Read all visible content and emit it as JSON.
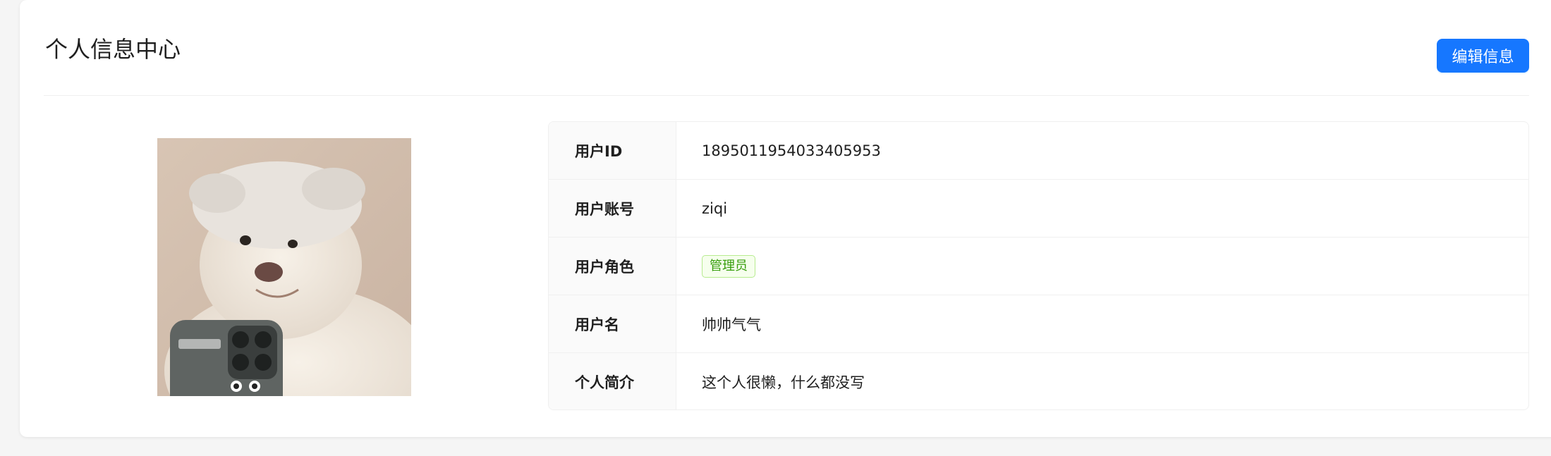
{
  "header": {
    "title": "个人信息中心",
    "edit_button_label": "编辑信息"
  },
  "avatar": {
    "alt": "用户头像"
  },
  "profile": {
    "rows": [
      {
        "label": "用户ID",
        "value": "1895011954033405953"
      },
      {
        "label": "用户账号",
        "value": "ziqi"
      },
      {
        "label": "用户角色",
        "value": "管理员"
      },
      {
        "label": "用户名",
        "value": "帅帅气气"
      },
      {
        "label": "个人简介",
        "value": "这个人很懒，什么都没写"
      }
    ]
  },
  "colors": {
    "primary": "#1677ff",
    "tag_green": "#389e0d",
    "tag_bg": "#f6ffed",
    "tag_border": "#b7eb8f"
  }
}
